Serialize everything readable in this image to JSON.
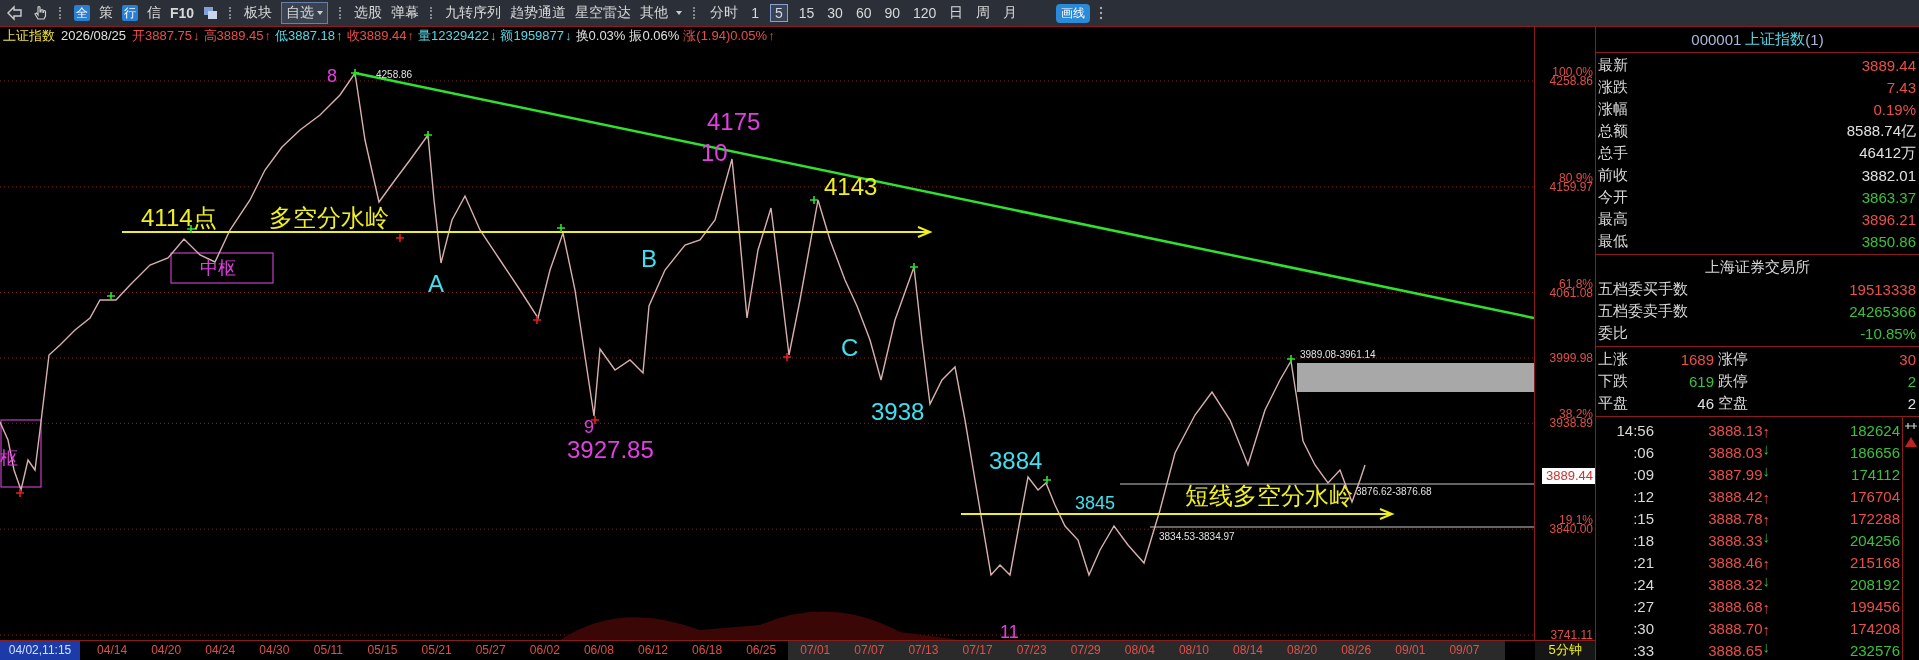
{
  "toolbar": {
    "tools": [
      {
        "label": "全",
        "kind": "badge"
      },
      {
        "label": "策",
        "kind": "text"
      },
      {
        "label": "行",
        "kind": "badge"
      },
      {
        "label": "信",
        "kind": "text"
      },
      {
        "label": "F10",
        "kind": "text"
      }
    ],
    "menus": [
      {
        "label": "板块",
        "kind": "text"
      },
      {
        "label": "自选",
        "kind": "dropdown"
      },
      {
        "label": "选股",
        "kind": "text"
      },
      {
        "label": "弹幕",
        "kind": "text"
      },
      {
        "label": "九转序列",
        "kind": "text"
      },
      {
        "label": "趋势通道",
        "kind": "text"
      },
      {
        "label": "星空雷达",
        "kind": "text"
      },
      {
        "label": "其他",
        "kind": "caret"
      }
    ],
    "periods": [
      {
        "label": "分时",
        "selected": false
      },
      {
        "label": "1",
        "selected": false
      },
      {
        "label": "5",
        "selected": true
      },
      {
        "label": "15",
        "selected": false
      },
      {
        "label": "30",
        "selected": false
      },
      {
        "label": "60",
        "selected": false
      },
      {
        "label": "90",
        "selected": false
      },
      {
        "label": "120",
        "selected": false
      },
      {
        "label": "日",
        "selected": false
      },
      {
        "label": "周",
        "selected": false
      },
      {
        "label": "月",
        "selected": false
      }
    ],
    "draw_button": "画线"
  },
  "info": {
    "name": "上证指数",
    "date": "2026/08/25",
    "items": [
      {
        "label": "开",
        "value": "3887.75",
        "arrow": "↓",
        "color": "#e8504a"
      },
      {
        "label": "高",
        "value": "3889.45",
        "arrow": "↑",
        "color": "#e8504a"
      },
      {
        "label": "低",
        "value": "3887.18",
        "arrow": "↑",
        "color": "#58d8e8"
      },
      {
        "label": "收",
        "value": "3889.44",
        "arrow": "↑",
        "color": "#e8504a"
      },
      {
        "label": "量",
        "value": "12329422",
        "arrow": "↓",
        "color": "#58d8e8"
      },
      {
        "label": "额",
        "value": "1959877",
        "arrow": "↓",
        "color": "#58d8e8"
      },
      {
        "label": "换",
        "value": "0.03%",
        "color": "#e0e0e0"
      },
      {
        "label": "振",
        "value": "0.06%",
        "color": "#e0e0e0"
      },
      {
        "label": "涨",
        "value": "(1.94)0.05%",
        "arrow": "↑",
        "color": "#e8504a"
      }
    ]
  },
  "chart": {
    "annotations": [
      {
        "text": "8",
        "kind": "medium",
        "color": "#e040e0"
      },
      {
        "text": "4258.86",
        "kind": "small",
        "color": "#e0e0e0"
      },
      {
        "text": "4114点",
        "kind": "big",
        "color": "#f0f020"
      },
      {
        "text": "多空分水岭",
        "kind": "big",
        "color": "#f0f020"
      },
      {
        "text": "中枢",
        "kind": "medium",
        "color": "#e040e0"
      },
      {
        "text": "枢",
        "kind": "medium",
        "color": "#e040e0"
      },
      {
        "text": "4175",
        "kind": "big",
        "color": "#e040e0"
      },
      {
        "text": "10",
        "kind": "big",
        "color": "#e040e0"
      },
      {
        "text": "4143",
        "kind": "big",
        "color": "#f0f020"
      },
      {
        "text": "A",
        "kind": "big",
        "color": "#40e0f0"
      },
      {
        "text": "B",
        "kind": "big",
        "color": "#40e0f0"
      },
      {
        "text": "C",
        "kind": "big",
        "color": "#40e0f0"
      },
      {
        "text": "9",
        "kind": "medium",
        "color": "#e040e0"
      },
      {
        "text": "3927.85",
        "kind": "big",
        "color": "#e040e0"
      },
      {
        "text": "3938",
        "kind": "big",
        "color": "#40e0f0"
      },
      {
        "text": "3884",
        "kind": "big",
        "color": "#40e0f0"
      },
      {
        "text": "3845",
        "kind": "medium",
        "color": "#40e0f0"
      },
      {
        "text": "3989.08-3961.14",
        "kind": "small",
        "color": "#e0e0e0"
      },
      {
        "text": "短线多空分水岭",
        "kind": "big",
        "color": "#f0f020"
      },
      {
        "text": "3876.62-3876.68",
        "kind": "small",
        "color": "#e0e0e0"
      },
      {
        "text": "3834.53-3834.97",
        "kind": "small",
        "color": "#e0e0e0"
      },
      {
        "text": "11",
        "kind": "medium",
        "color": "#e040e0"
      }
    ]
  },
  "price_axis": [
    {
      "percent": "100.0%",
      "price": "4258.86"
    },
    {
      "percent": "80.9%",
      "price": "4159.97"
    },
    {
      "percent": "61.8%",
      "price": "4061.08"
    },
    {
      "price": "3999.98"
    },
    {
      "percent": "38.2%",
      "price": "3938.89"
    },
    {
      "percent": "19.1%",
      "price": "3840.00"
    },
    {
      "price": "3741.11"
    }
  ],
  "current_price": "3889.44",
  "date_axis": {
    "labels": [
      {
        "text": "04/02,11:15",
        "kind": "cursor"
      },
      {
        "text": "04/14",
        "kind": "plain"
      },
      {
        "text": "04/20",
        "kind": "plain"
      },
      {
        "text": "04/24",
        "kind": "plain"
      },
      {
        "text": "04/30",
        "kind": "plain"
      },
      {
        "text": "05/11",
        "kind": "plain"
      },
      {
        "text": "05/15",
        "kind": "plain"
      },
      {
        "text": "05/21",
        "kind": "plain"
      },
      {
        "text": "05/27",
        "kind": "plain"
      },
      {
        "text": "06/02",
        "kind": "plain"
      },
      {
        "text": "06/08",
        "kind": "plain"
      },
      {
        "text": "06/12",
        "kind": "plain"
      },
      {
        "text": "06/18",
        "kind": "plain"
      },
      {
        "text": "06/25",
        "kind": "plain"
      },
      {
        "text": "07/01",
        "kind": "shaded"
      },
      {
        "text": "07/07",
        "kind": "shaded"
      },
      {
        "text": "07/13",
        "kind": "shaded"
      },
      {
        "text": "07/17",
        "kind": "shaded"
      },
      {
        "text": "07/23",
        "kind": "shaded"
      },
      {
        "text": "07/29",
        "kind": "shaded"
      },
      {
        "text": "08/04",
        "kind": "shaded"
      },
      {
        "text": "08/10",
        "kind": "shaded"
      },
      {
        "text": "08/14",
        "kind": "shaded"
      },
      {
        "text": "08/20",
        "kind": "shaded"
      },
      {
        "text": "08/26",
        "kind": "shaded"
      },
      {
        "text": "09/01",
        "kind": "shaded"
      },
      {
        "text": "09/07",
        "kind": "shaded"
      }
    ],
    "period": "5分钟"
  },
  "panel": {
    "code": "000001",
    "name": "上证指数",
    "suffix": "(1)",
    "quotes": [
      {
        "label": "最新",
        "value": "3889.44",
        "color": "#e8504a"
      },
      {
        "label": "涨跌",
        "value": "7.43",
        "color": "#e8504a"
      },
      {
        "label": "涨幅",
        "value": "0.19%",
        "color": "#e8504a"
      },
      {
        "label": "总额",
        "value": "8588.74亿",
        "color": "#e0e0e0"
      },
      {
        "label": "总手",
        "value": "46412万",
        "color": "#e0e0e0"
      },
      {
        "label": "前收",
        "value": "3882.01",
        "color": "#e0e0e0"
      },
      {
        "label": "今开",
        "value": "3863.37",
        "color": "#3cc03c"
      },
      {
        "label": "最高",
        "value": "3896.21",
        "color": "#e8504a"
      },
      {
        "label": "最低",
        "value": "3850.86",
        "color": "#3cc03c"
      }
    ],
    "exchange": "上海证券交易所",
    "orders": [
      {
        "label": "五档委买手数",
        "value": "19513338",
        "color": "#e8504a"
      },
      {
        "label": "五档委卖手数",
        "value": "24265366",
        "color": "#3cc03c"
      },
      {
        "label": "委比",
        "value": "-10.85%",
        "color": "#3cc03c"
      }
    ],
    "breadth": [
      {
        "label": "上涨",
        "count": "1689",
        "label2": "涨停",
        "count2": "30",
        "color": "#e8504a"
      },
      {
        "label": "下跌",
        "count": "619",
        "label2": "跌停",
        "count2": "2",
        "color": "#3cc03c"
      },
      {
        "label": "平盘",
        "count": "46",
        "label2": "空盘",
        "count2": "2",
        "color": "#e0e0e0"
      }
    ],
    "ticks": [
      {
        "time": "14:56",
        "price": "3888.13",
        "arrow": "↑",
        "rising": true,
        "volume": "182624",
        "color": "#3cc03c"
      },
      {
        "time": ":06",
        "price": "3888.03",
        "arrow": "↓",
        "rising": false,
        "volume": "186656",
        "color": "#3cc03c"
      },
      {
        "time": ":09",
        "price": "3887.99",
        "arrow": "↓",
        "rising": false,
        "volume": "174112",
        "color": "#3cc03c"
      },
      {
        "time": ":12",
        "price": "3888.42",
        "arrow": "↑",
        "rising": true,
        "volume": "176704",
        "color": "#e8504a"
      },
      {
        "time": ":15",
        "price": "3888.78",
        "arrow": "↑",
        "rising": true,
        "volume": "172288",
        "color": "#e8504a"
      },
      {
        "time": ":18",
        "price": "3888.33",
        "arrow": "↓",
        "rising": false,
        "volume": "204256",
        "color": "#3cc03c"
      },
      {
        "time": ":21",
        "price": "3888.46",
        "arrow": "↑",
        "rising": true,
        "volume": "215168",
        "color": "#e8504a"
      },
      {
        "time": ":24",
        "price": "3888.32",
        "arrow": "↓",
        "rising": false,
        "volume": "208192",
        "color": "#3cc03c"
      },
      {
        "time": ":27",
        "price": "3888.68",
        "arrow": "↑",
        "rising": true,
        "volume": "199456",
        "color": "#e8504a"
      },
      {
        "time": ":30",
        "price": "3888.70",
        "arrow": "↑",
        "rising": true,
        "volume": "174208",
        "color": "#e8504a"
      },
      {
        "time": ":33",
        "price": "3888.65",
        "arrow": "↓",
        "rising": false,
        "volume": "232576",
        "color": "#3cc03c"
      }
    ]
  }
}
